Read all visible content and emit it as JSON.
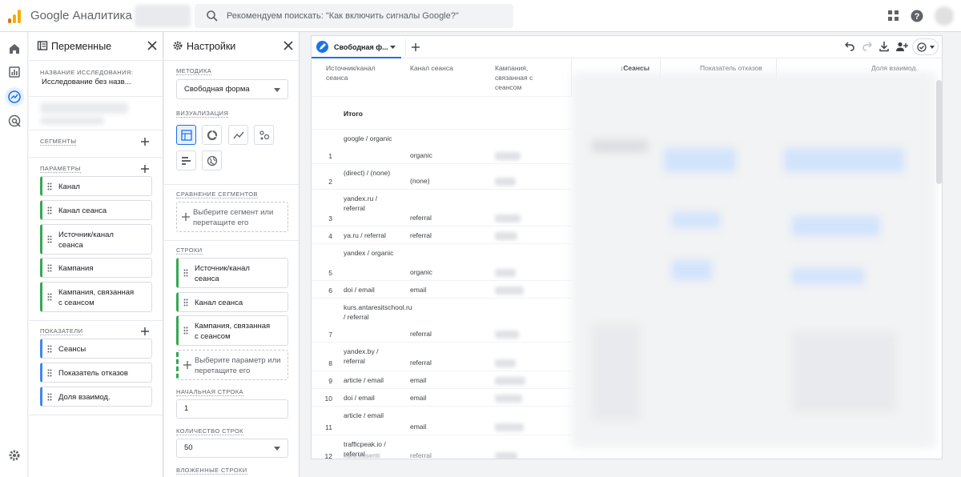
{
  "app": {
    "title": "Google Аналитика",
    "search_placeholder": "Рекомендуем поискать: \"Как включить сигналы Google?\""
  },
  "colors": {
    "accent": "#1a73e8",
    "dimension": "#34a853",
    "metric": "#4285f4",
    "logo_orange": "#f9ab00",
    "logo_dark": "#e37400"
  },
  "rail": {
    "items": [
      "home-icon",
      "reports-icon",
      "explore-icon",
      "advertising-icon",
      "settings-icon"
    ],
    "active": "explore-icon"
  },
  "variables": {
    "title": "Переменные",
    "exploration_label": "НАЗВАНИЕ ИССЛЕДОВАНИЯ:",
    "exploration_name": "Исследование без назв...",
    "segments_label": "СЕГМЕНТЫ",
    "dimensions_label": "ПАРАМЕТРЫ",
    "dimensions": [
      "Канал",
      "Канал сеанса",
      "Источник/канал сеанса",
      "Кампания",
      "Кампания, связанная с сеансом"
    ],
    "metrics_label": "ПОКАЗАТЕЛИ",
    "metrics": [
      "Сеансы",
      "Показатель отказов",
      "Доля взаимод."
    ]
  },
  "settings": {
    "title": "Настройки",
    "technique_label": "МЕТОДИКА",
    "technique_value": "Свободная форма",
    "visualization_label": "ВИЗУАЛИЗАЦИЯ",
    "segment_compare_label": "СРАВНЕНИЕ СЕГМЕНТОВ",
    "segment_drop": "Выберите сегмент или перетащите его",
    "rows_label": "СТРОКИ",
    "rows": [
      "Источник/канал сеанса",
      "Канал сеанса",
      "Кампания, связанная с сеансом"
    ],
    "rows_drop": "Выберите параметр или перетащите его",
    "start_row_label": "НАЧАЛЬНАЯ СТРОКА",
    "start_row_value": "1",
    "row_count_label": "КОЛИЧЕСТВО СТРОК",
    "row_count_value": "50",
    "nested_rows_label": "ВЛОЖЕННЫЕ СТРОКИ"
  },
  "report": {
    "tab_label": "Свободная ф...",
    "headers": {
      "source": "Источник/канал сеанса",
      "channel": "Канал сеанса",
      "campaign": "Кампания, связанная с сеансом",
      "sessions": "Сеансы",
      "bounce": "Показатель отказов",
      "engagement": "Доля взаимод."
    },
    "sort_arrow": "↓",
    "total_label": "Итого",
    "rows": [
      {
        "n": "1",
        "source": "google / organic",
        "channel": "organic"
      },
      {
        "n": "2",
        "source": "(direct) / (none)",
        "channel": "(none)"
      },
      {
        "n": "3",
        "source": "yandex.ru / referral",
        "channel": "referral"
      },
      {
        "n": "4",
        "source": "ya.ru / referral",
        "channel": "referral"
      },
      {
        "n": "5",
        "source": "yandex / organic",
        "channel": "organic"
      },
      {
        "n": "6",
        "source": "doi / email",
        "channel": "email"
      },
      {
        "n": "7",
        "source": "kurs.antaresitschool.ru / referral",
        "channel": "referral"
      },
      {
        "n": "8",
        "source": "yandex.by / referral",
        "channel": "referral"
      },
      {
        "n": "9",
        "source": "article / email",
        "channel": "email"
      },
      {
        "n": "10",
        "source": "doi / email",
        "channel": "email"
      },
      {
        "n": "11",
        "source": "article / email",
        "channel": "email"
      },
      {
        "n": "12",
        "source": "trafficpeak.io / referral",
        "channel": "referral"
      }
    ],
    "partial_row": "kurs.essenti"
  }
}
